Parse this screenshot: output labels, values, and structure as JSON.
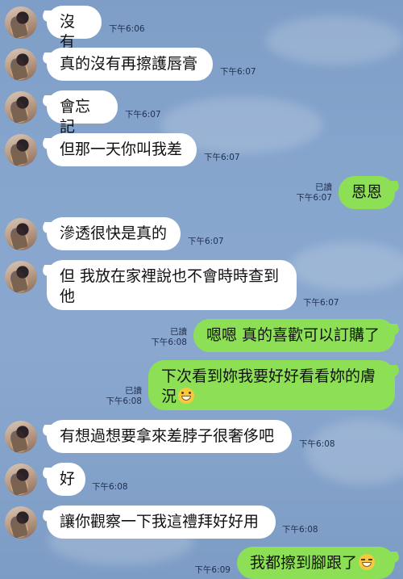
{
  "messages": [
    {
      "side": "in",
      "text": "沒有",
      "time": "下午6:06"
    },
    {
      "side": "in",
      "text": "真的沒有再擦護唇膏",
      "time": "下午6:07"
    },
    {
      "side": "in",
      "text": "會忘記",
      "time": "下午6:07"
    },
    {
      "side": "in",
      "text": "但那一天你叫我差",
      "time": "下午6:07"
    },
    {
      "side": "out",
      "text": "恩恩",
      "read": "已讀",
      "time": "下午6:07"
    },
    {
      "side": "in",
      "text": "滲透很快是真的",
      "time": "下午6:07"
    },
    {
      "side": "in",
      "text_line1": "但 我放在家裡說也不會時時查到",
      "text_line2": "他",
      "time": "下午6:07"
    },
    {
      "side": "out",
      "text": "嗯嗯 真的喜歡可以訂購了",
      "read": "已讀",
      "time": "下午6:08"
    },
    {
      "side": "out",
      "text_line1": "下次看到妳我要好好看看妳的膚",
      "text_line2": "況",
      "emoji": "grinning-face",
      "read": "已讀",
      "time": "下午6:08"
    },
    {
      "side": "in",
      "text": "有想過想要拿來差脖子很奢侈吧",
      "time": "下午6:08"
    },
    {
      "side": "in",
      "text": "好",
      "time": "下午6:08"
    },
    {
      "side": "in",
      "text": "讓你觀察一下我這禮拜好好用",
      "time": "下午6:08"
    },
    {
      "side": "out",
      "text": "我都擦到腳跟了",
      "emoji": "squinting-laughing-face",
      "time": "下午6:09"
    }
  ]
}
